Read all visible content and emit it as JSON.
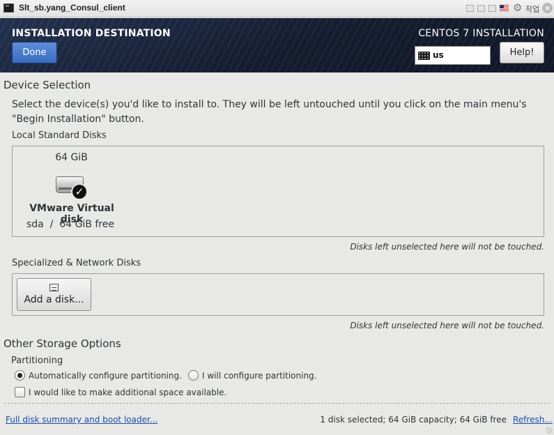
{
  "window": {
    "title": "Slt_sb.yang_Consul_client",
    "task_label": "작업"
  },
  "header": {
    "spoke_title": "INSTALLATION DESTINATION",
    "done_label": "Done",
    "product_title": "CENTOS 7 INSTALLATION",
    "keyboard_layout": "us",
    "help_label": "Help!"
  },
  "device_selection": {
    "heading": "Device Selection",
    "intro": "Select the device(s) you'd like to install to.  They will be left untouched until you click on the main menu's \"Begin Installation\" button.",
    "local_heading": "Local Standard Disks",
    "disks": [
      {
        "capacity": "64 GiB",
        "name": "VMware Virtual disk",
        "info": "sda  /  64 GiB free",
        "selected": true
      }
    ],
    "local_note": "Disks left unselected here will not be touched.",
    "specialized_heading": "Specialized & Network Disks",
    "add_disk_label": "Add a disk...",
    "specialized_note": "Disks left unselected here will not be touched."
  },
  "other_storage": {
    "heading": "Other Storage Options",
    "partitioning_label": "Partitioning",
    "auto_label": "Automatically configure partitioning.",
    "manual_label": "I will configure partitioning.",
    "selected": "auto",
    "reclaim_label": "I would like to make additional space available.",
    "reclaim_checked": false
  },
  "footer": {
    "summary_link": "Full disk summary and boot loader...",
    "status": "1 disk selected; 64 GiB capacity; 64 GiB free",
    "refresh_link": "Refresh..."
  },
  "icons": [
    "terminal-icon",
    "keyboard-icon",
    "hard-disk-icon",
    "checkmark-icon",
    "add-disk-icon",
    "gear-icon",
    "flag-icon",
    "close-icon"
  ],
  "colors": {
    "header_bg": "#1a2438",
    "done_button": "#4a7fcf",
    "link": "#1b4fa6",
    "background": "#e8e8e7"
  }
}
